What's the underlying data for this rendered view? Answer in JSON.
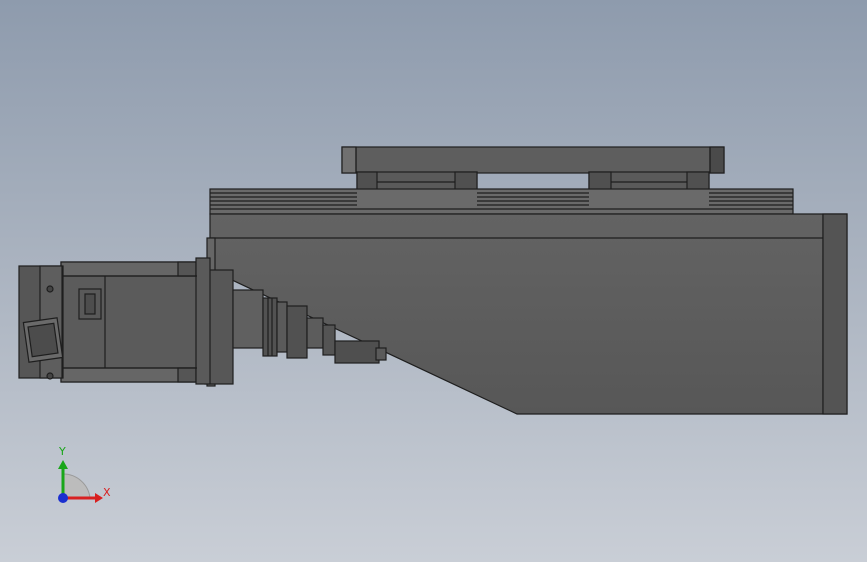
{
  "viewport": {
    "background_top": "#8e9bad",
    "background_bottom": "#c9ced6"
  },
  "model": {
    "body_color": "#5b5b5b",
    "edge_color": "#1e1e1e",
    "highlight_color": "#7a7a7a"
  },
  "triad": {
    "x_label": "X",
    "y_label": "Y",
    "x_color": "#d82020",
    "y_color": "#19a619",
    "z_color": "#1a2fd0"
  }
}
